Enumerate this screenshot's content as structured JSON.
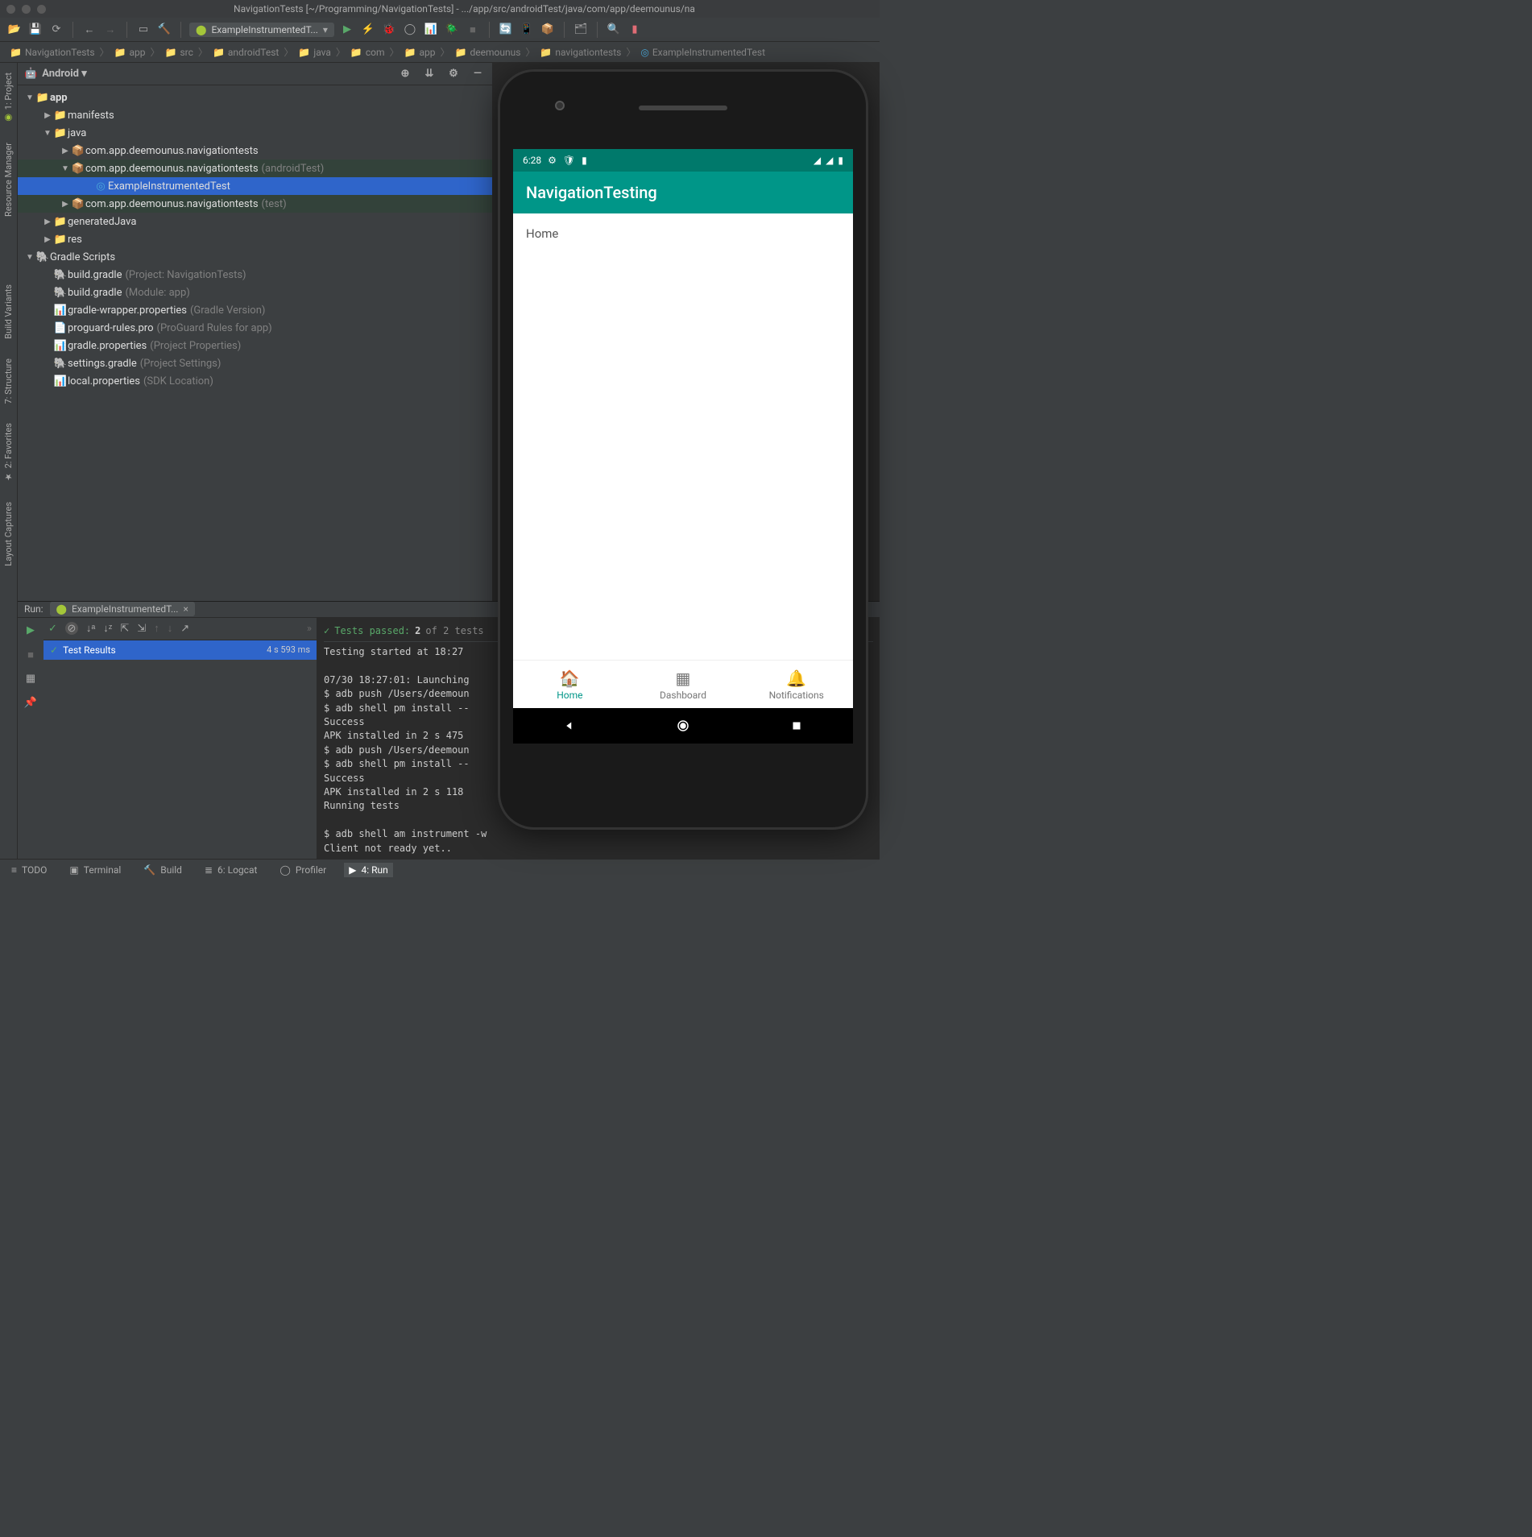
{
  "window": {
    "title": "NavigationTests [~/Programming/NavigationTests] - .../app/src/androidTest/java/com/app/deemounus/na"
  },
  "toolbar": {
    "run_config": "ExampleInstrumentedT..."
  },
  "breadcrumbs": [
    "NavigationTests",
    "app",
    "src",
    "androidTest",
    "java",
    "com",
    "app",
    "deemounus",
    "navigationtests",
    "ExampleInstrumentedTest"
  ],
  "project": {
    "dropdown": "Android",
    "tree": {
      "app": "app",
      "manifests": "manifests",
      "java": "java",
      "pkg_main": "com.app.deemounus.navigationtests",
      "pkg_androidTest": "com.app.deemounus.navigationtests",
      "pkg_androidTest_hint": "(androidTest)",
      "example_test": "ExampleInstrumentedTest",
      "pkg_test": "com.app.deemounus.navigationtests",
      "pkg_test_hint": "(test)",
      "generatedJava": "generatedJava",
      "res": "res",
      "gradle_scripts": "Gradle Scripts",
      "build_gradle_proj": "build.gradle",
      "build_gradle_proj_hint": "(Project: NavigationTests)",
      "build_gradle_app": "build.gradle",
      "build_gradle_app_hint": "(Module: app)",
      "gradle_wrapper": "gradle-wrapper.properties",
      "gradle_wrapper_hint": "(Gradle Version)",
      "proguard": "proguard-rules.pro",
      "proguard_hint": "(ProGuard Rules for app)",
      "gradle_props": "gradle.properties",
      "gradle_props_hint": "(Project Properties)",
      "settings_gradle": "settings.gradle",
      "settings_gradle_hint": "(Project Settings)",
      "local_props": "local.properties",
      "local_props_hint": "(SDK Location)"
    }
  },
  "left_tabs": {
    "project": "1: Project",
    "resource_manager": "Resource Manager",
    "build_variants": "Build Variants",
    "structure": "7: Structure",
    "favorites": "2: Favorites",
    "layout_captures": "Layout Captures"
  },
  "run": {
    "label": "Run:",
    "tab": "ExampleInstrumentedT...",
    "tests_passed": "Tests passed:",
    "tests_count": "2",
    "tests_total": "of 2 tests",
    "result_row": "Test Results",
    "result_time": "4 s 593 ms",
    "console": "Testing started at 18:27\n\n07/30 18:27:01: Launching\n$ adb push /Users/deemoun\n$ adb shell pm install --\nSuccess\nAPK installed in 2 s 475 \n$ adb push /Users/deemoun\n$ adb shell pm install --\nSuccess\nAPK installed in 2 s 118 \nRunning tests\n\n$ adb shell am instrument -w\nClient not ready yet.."
  },
  "statusbar": {
    "todo": "TODO",
    "terminal": "Terminal",
    "build": "Build",
    "logcat": "6: Logcat",
    "profiler": "Profiler",
    "run": "4: Run"
  },
  "phone": {
    "time": "6:28",
    "app_title": "NavigationTesting",
    "body": "Home",
    "nav": {
      "home": "Home",
      "dashboard": "Dashboard",
      "notifications": "Notifications"
    }
  }
}
